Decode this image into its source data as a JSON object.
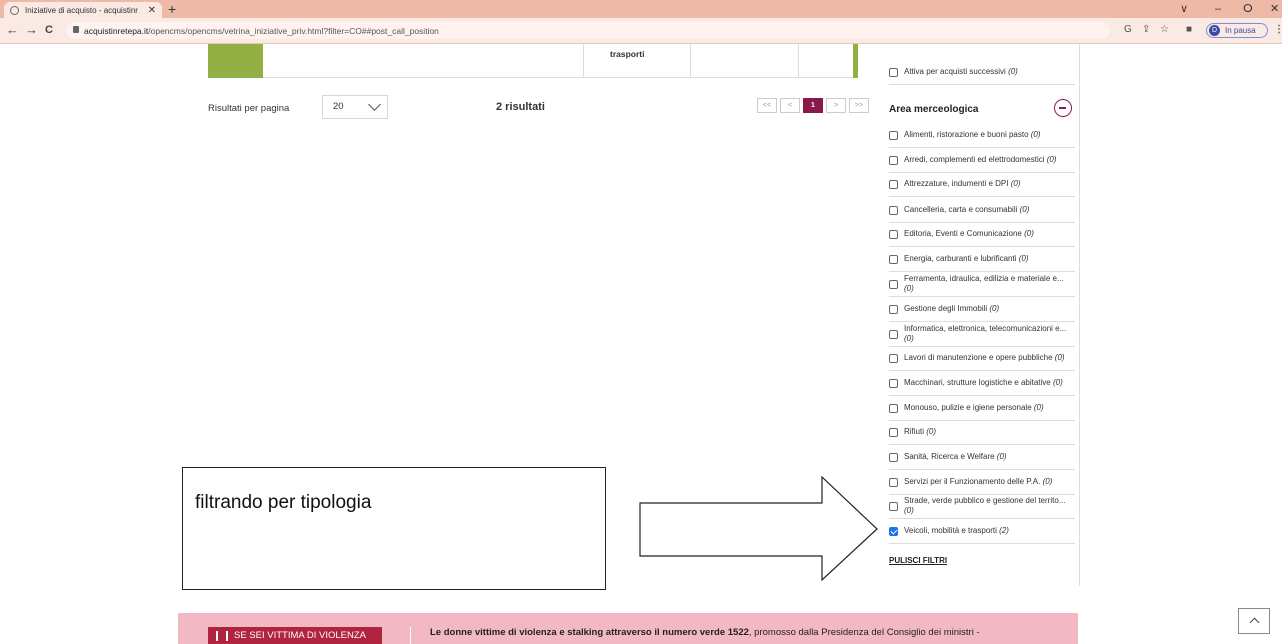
{
  "browser": {
    "tab_title": "Iniziative di acquisto - acquistinr",
    "tab_close": "✕",
    "new_tab": "+",
    "url_host": "acquistinretepa.it",
    "url_path": "/opencms/opencms/vetrina_iniziative_priv.html?filter=CO##post_call_position",
    "profile_initial": "D",
    "profile_status": "In pausa",
    "nav": {
      "back": "←",
      "forward": "→",
      "reload": "C"
    },
    "window_controls": {
      "menu": "∨",
      "minimize": "–",
      "maximize": "ⵔ",
      "close": "✕"
    }
  },
  "table": {
    "last_cell": "trasporti"
  },
  "results": {
    "per_page_label": "Risultati per pagina",
    "per_page_value": "20",
    "count": "2 risultati",
    "pager": {
      "first": "<<",
      "prev": "<",
      "current": "1",
      "next": ">",
      "last": ">>"
    }
  },
  "sidebar": {
    "top_filter": {
      "label": "Attiva per acquisti successivi",
      "count": "(0)",
      "checked": false
    },
    "area_title": "Area merceologica",
    "items": [
      {
        "label": "Alimenti, ristorazione e buoni pasto",
        "count": "(0)",
        "checked": false
      },
      {
        "label": "Arredi, complementi ed elettrodomestici",
        "count": "(0)",
        "checked": false
      },
      {
        "label": "Attrezzature, indumenti e DPI",
        "count": "(0)",
        "checked": false
      },
      {
        "label": "Cancelleria, carta e consumabili",
        "count": "(0)",
        "checked": false
      },
      {
        "label": "Editoria, Eventi e Comunicazione",
        "count": "(0)",
        "checked": false
      },
      {
        "label": "Energia, carburanti e lubrificanti",
        "count": "(0)",
        "checked": false
      },
      {
        "label": "Ferramenta, idraulica, edilizia e materiale e...",
        "count": "(0)",
        "checked": false
      },
      {
        "label": "Gestione degli Immobili",
        "count": "(0)",
        "checked": false
      },
      {
        "label": "Informatica, elettronica, telecomunicazioni e...",
        "count": "(0)",
        "checked": false
      },
      {
        "label": "Lavori di manutenzione e opere pubbliche",
        "count": "(0)",
        "checked": false
      },
      {
        "label": "Macchinari, strutture logistiche e abitative",
        "count": "(0)",
        "checked": false
      },
      {
        "label": "Monouso, pulizie e igiene personale",
        "count": "(0)",
        "checked": false
      },
      {
        "label": "Rifiuti",
        "count": "(0)",
        "checked": false
      },
      {
        "label": "Sanità, Ricerca e Welfare",
        "count": "(0)",
        "checked": false
      },
      {
        "label": "Servizi per il Funzionamento delle P.A.",
        "count": "(0)",
        "checked": false
      },
      {
        "label": "Strade, verde pubblico e gestione del territo...",
        "count": "(0)",
        "checked": false
      },
      {
        "label": "Veicoli, mobilità e trasporti",
        "count": "(2)",
        "checked": true
      }
    ],
    "clear_filters": "PULISCI FILTRI"
  },
  "annotation": {
    "text": "filtrando per tipologia"
  },
  "banner": {
    "badge": "SE SEI VITTIMA DI VIOLENZA",
    "text_bold": "Le donne vittime di violenza e stalking attraverso il numero verde 1522",
    "text_rest": ", promosso dalla Presidenza del Consiglio dei ministri -"
  },
  "colors": {
    "accent": "#8a1a4e",
    "green": "#93b045",
    "checkbox": "#1a73e8",
    "banner": "#f2b8c4"
  }
}
